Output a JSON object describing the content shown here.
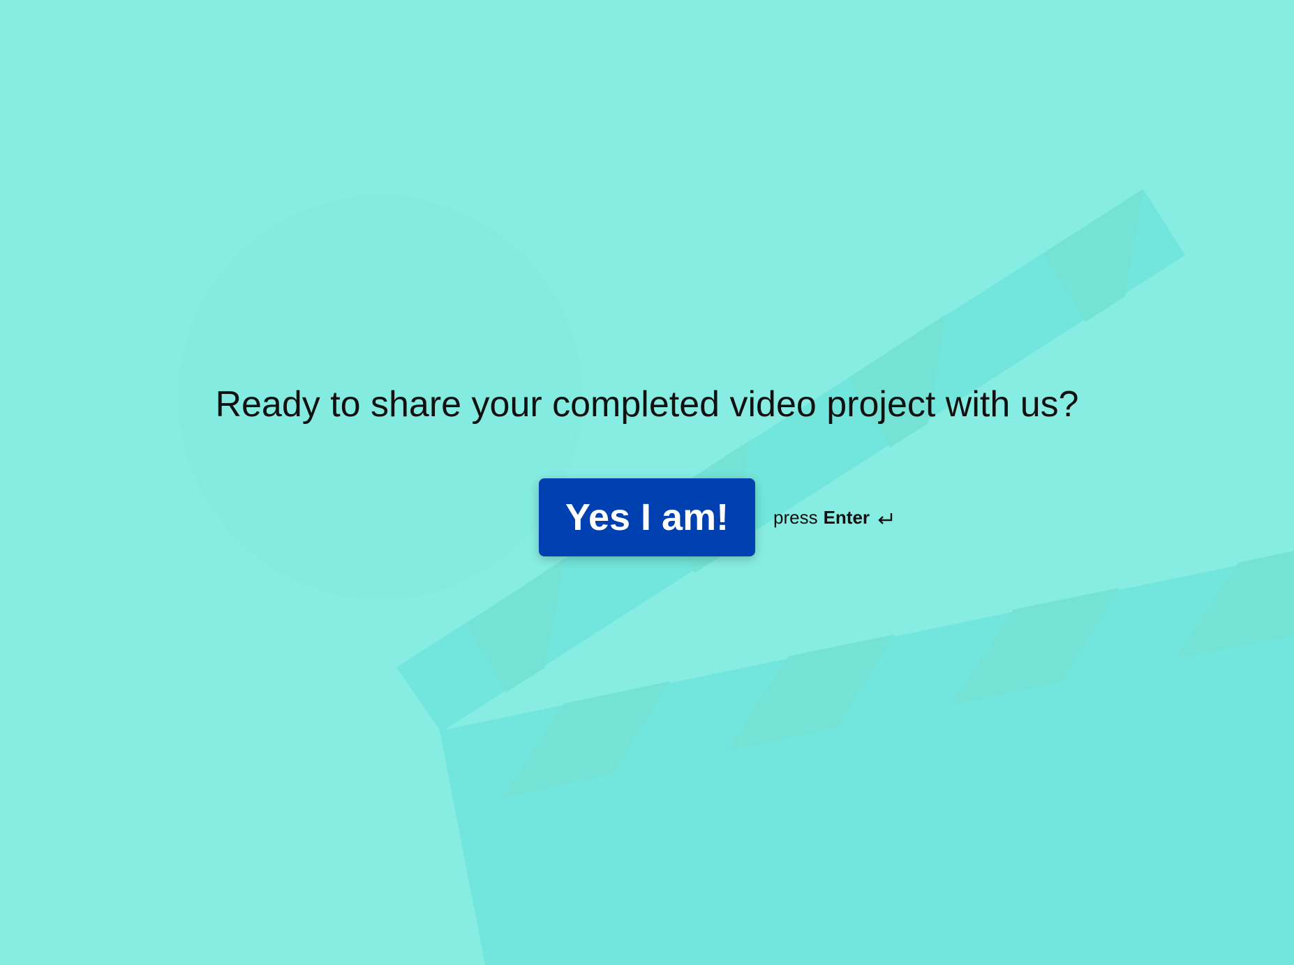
{
  "background": {
    "color": "#87ede2",
    "accent_color": "#72e6dc",
    "stripe_color": "#74e3d6",
    "illustration": "clapperboard"
  },
  "question": {
    "text": "Ready to share your completed video project with us?"
  },
  "actions": {
    "confirm_label": "Yes I am!",
    "confirm_color": "#0040b0",
    "hint_prefix": "press",
    "hint_key": "Enter",
    "hint_icon": "enter-key-icon"
  }
}
